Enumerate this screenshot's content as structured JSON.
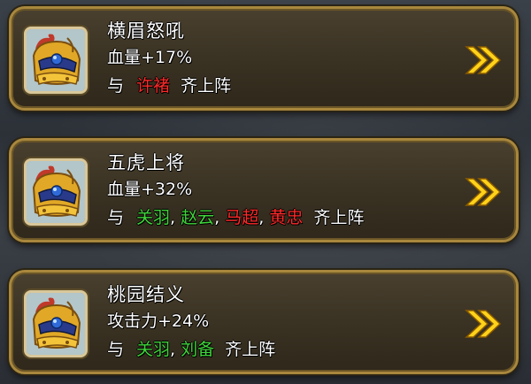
{
  "colors": {
    "hero_red": "#ff2a2a",
    "hero_green": "#3fd43a",
    "text_white": "#ffffff",
    "chevron_yellow": "#ffd21a",
    "frame_gold": "#a8873d"
  },
  "cards": [
    {
      "title": "横眉怒吼",
      "bonus": "血量+17%",
      "prefix": "与",
      "heroes": [
        {
          "name": "许褚",
          "color": "red",
          "comma": ""
        }
      ],
      "suffix": "齐上阵",
      "avatar_icon": "helmet-portrait-icon",
      "action_icon": "double-chevron-right-icon"
    },
    {
      "title": "五虎上将",
      "bonus": "血量+32%",
      "prefix": "与",
      "heroes": [
        {
          "name": "关羽",
          "color": "green",
          "comma": ","
        },
        {
          "name": "赵云",
          "color": "green",
          "comma": ","
        },
        {
          "name": "马超",
          "color": "red",
          "comma": ","
        },
        {
          "name": "黄忠",
          "color": "red",
          "comma": ""
        }
      ],
      "suffix": "齐上阵",
      "avatar_icon": "helmet-portrait-icon",
      "action_icon": "double-chevron-right-icon"
    },
    {
      "title": "桃园结义",
      "bonus": "攻击力+24%",
      "prefix": "与",
      "heroes": [
        {
          "name": "关羽",
          "color": "green",
          "comma": ","
        },
        {
          "name": "刘备",
          "color": "green",
          "comma": ""
        }
      ],
      "suffix": "齐上阵",
      "avatar_icon": "helmet-portrait-icon",
      "action_icon": "double-chevron-right-icon"
    }
  ]
}
